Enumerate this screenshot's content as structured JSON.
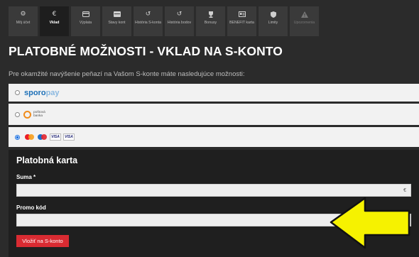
{
  "tabs": [
    {
      "label": "Môj účet",
      "icon": "gear-icon",
      "active": false
    },
    {
      "label": "Vklad",
      "icon": "euro-icon",
      "active": true
    },
    {
      "label": "Výplata",
      "icon": "card-icon",
      "active": false
    },
    {
      "label": "Stavy kont",
      "icon": "balance-icon",
      "active": false
    },
    {
      "label": "História S-konta",
      "icon": "history-icon",
      "active": false
    },
    {
      "label": "História bodov",
      "icon": "history-icon",
      "active": false
    },
    {
      "label": "Bonusy",
      "icon": "trophy-icon",
      "active": false
    },
    {
      "label": "BENEFIT karta",
      "icon": "id-card-icon",
      "active": false
    },
    {
      "label": "Limity",
      "icon": "shield-icon",
      "active": false
    },
    {
      "label": "Upozornenia",
      "icon": "warning-icon",
      "active": false
    }
  ],
  "page_title": "PLATOBNÉ MOŽNOSTI - VKLAD NA S-KONTO",
  "intro_text": "Pre okamžité navýšenie peňazí na Vašom S-konte máte nasledujúce možnosti:",
  "options": {
    "sporopay": {
      "brand_a": "sporo",
      "brand_b": "pay"
    },
    "postova": {
      "text": "poštová banka"
    },
    "cards": {
      "visa": "VISA"
    }
  },
  "panel": {
    "title": "Platobná karta",
    "amount_label": "Suma *",
    "amount_value": "",
    "currency": "€",
    "promo_label": "Promo kód",
    "promo_value": "",
    "submit_label": "Vložiť na S-konto"
  },
  "colors": {
    "background": "#2b2b2b",
    "submit": "#d92b32",
    "arrow": "#f6f200",
    "sporopay": "#1b6fb7"
  }
}
